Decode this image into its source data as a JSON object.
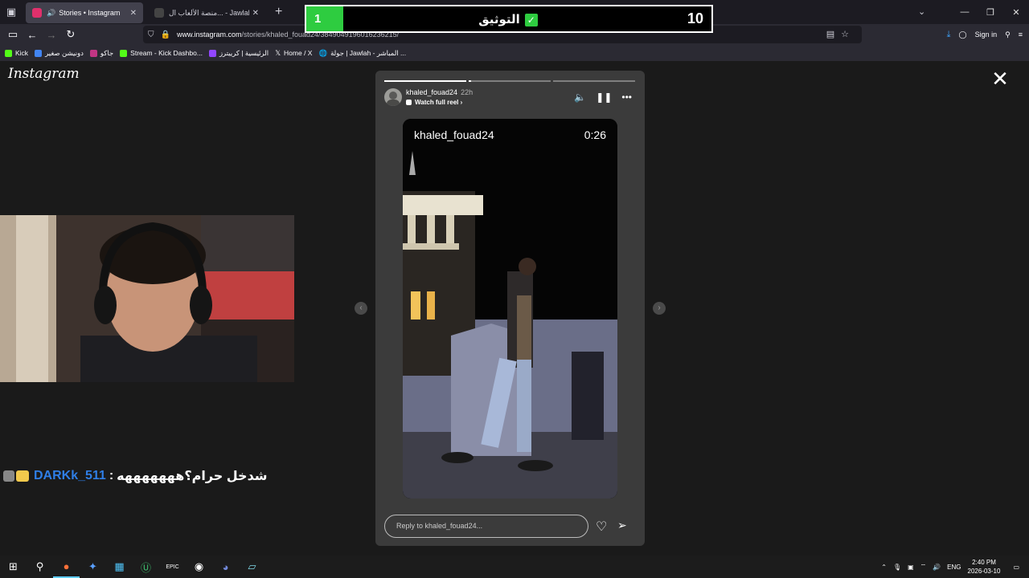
{
  "browser": {
    "tabs": [
      {
        "title": "Stories • Instagram",
        "active": true,
        "favicon_color": "#e1306c"
      },
      {
        "title": "منصة الألعاب ال... - Jawlah | جولة",
        "active": false,
        "favicon_color": "#ffffff"
      }
    ],
    "url_host": "www.instagram.com",
    "url_path": "/stories/khaled_fouad24/3849049196016236215/",
    "sign_in": "Sign in",
    "bookmarks": [
      {
        "label": "Kick",
        "color": "#53fc18"
      },
      {
        "label": "دونيشن صغير",
        "color": "#4285f4"
      },
      {
        "label": "جاكو",
        "color": "#c13584"
      },
      {
        "label": "Stream - Kick Dashbo...",
        "color": "#53fc18"
      },
      {
        "label": "الرئيسية | كرييترز",
        "color": "#9146ff"
      },
      {
        "label": "Home / X",
        "color": "#ffffff"
      },
      {
        "label": "جولة | Jawlah - المباشر ...",
        "color": "#cfcfd8"
      }
    ]
  },
  "overlay": {
    "left_score": "1",
    "center_text": "التوثيق",
    "check": "✓",
    "right_score": "10"
  },
  "instagram": {
    "logo": "Instagram",
    "story": {
      "username": "khaled_fouad24",
      "time_ago": "22h",
      "watch_full_reel": "Watch full reel",
      "video_username": "khaled_fouad24",
      "video_time": "0:26",
      "reply_placeholder": "Reply to khaled_fouad24...",
      "progress_segments": [
        1,
        0.03,
        0
      ]
    }
  },
  "chat": {
    "username": "DARKk_511",
    "separator": " :",
    "message": "شدخل حرام؟هههههههه"
  },
  "taskbar": {
    "language": "ENG",
    "time": "2:40 PM",
    "date": "2026-03-10"
  }
}
